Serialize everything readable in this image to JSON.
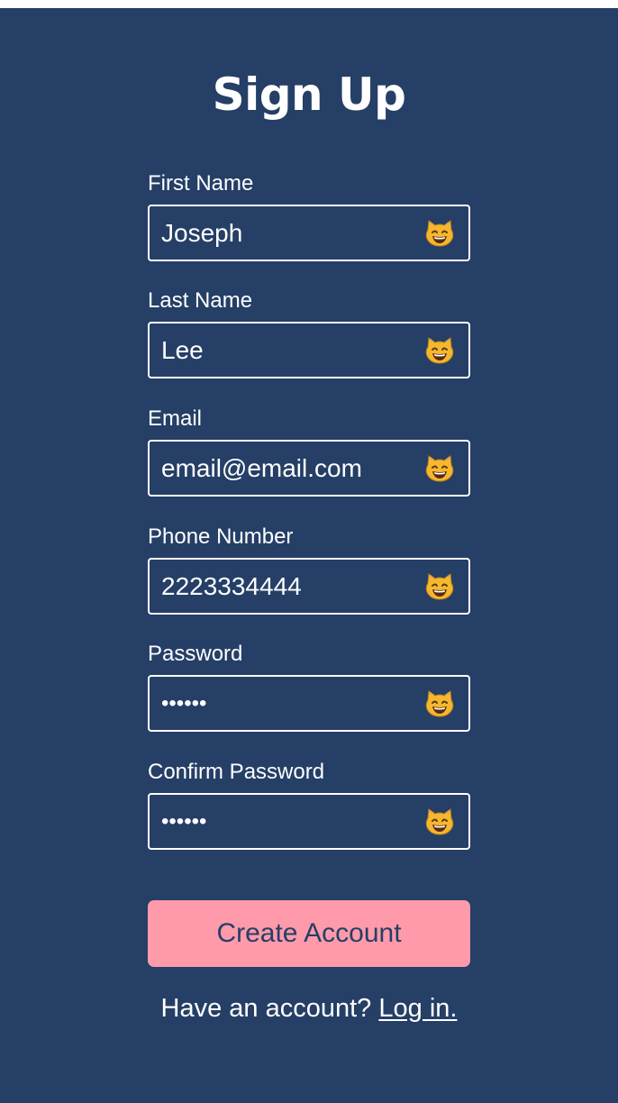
{
  "form": {
    "title": "Sign Up",
    "fields": [
      {
        "label": "First Name",
        "value": "Joseph",
        "type": "text"
      },
      {
        "label": "Last Name",
        "value": "Lee",
        "type": "text"
      },
      {
        "label": "Email",
        "value": "email@email.com",
        "type": "text"
      },
      {
        "label": "Phone Number",
        "value": "2223334444",
        "type": "text"
      },
      {
        "label": "Password",
        "value": "••••••",
        "type": "password"
      },
      {
        "label": "Confirm Password",
        "value": "••••••",
        "type": "password"
      }
    ],
    "field_icon": "smiling-cat-icon",
    "submit_label": "Create Account",
    "footer_text": "Have an account?",
    "footer_link": "Log in."
  },
  "colors": {
    "background": "#253f66",
    "button": "#ff9aab",
    "button_text": "#253f66",
    "text": "#ffffff"
  }
}
